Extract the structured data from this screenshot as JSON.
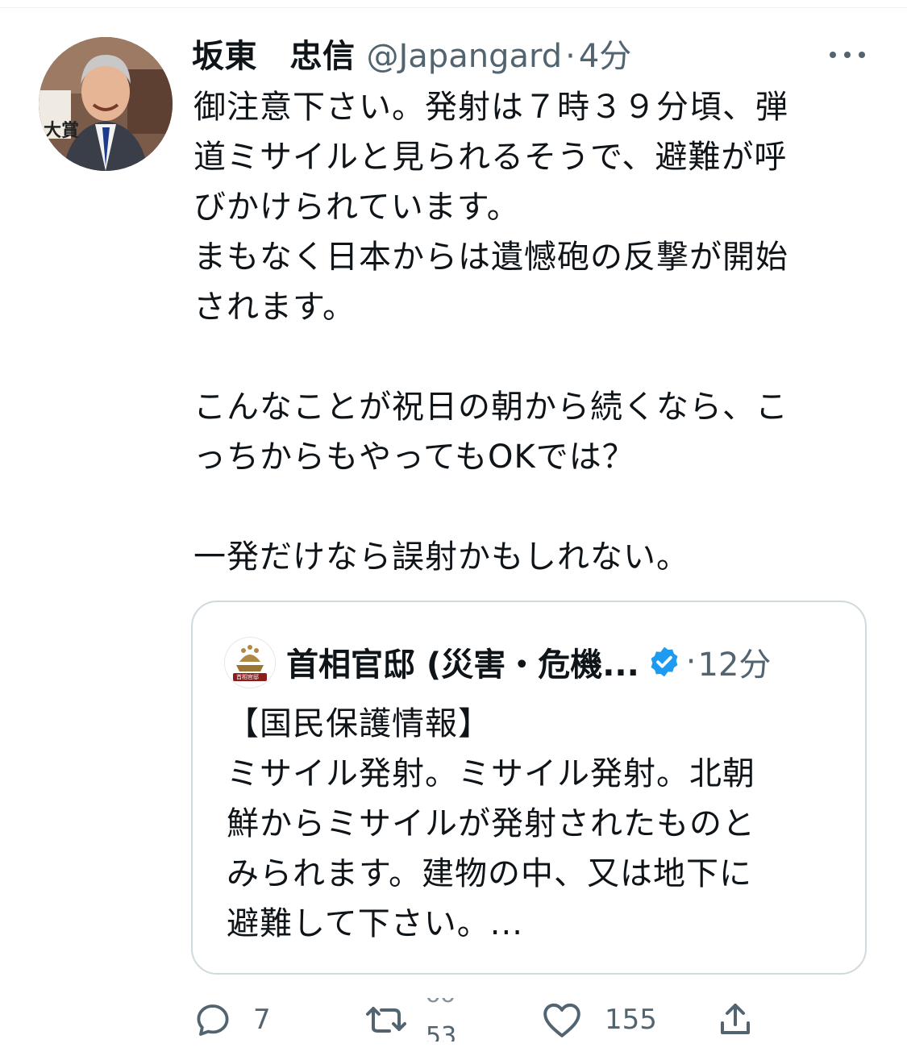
{
  "tweet": {
    "author_name": "坂東　忠信",
    "handle": "@Japangard",
    "separator": "·",
    "time": "4分",
    "avatar_badge": "大賞",
    "text_lines": [
      "御注意下さい。発射は７時３９分頃、弾",
      "道ミサイルと見られるそうで、避難が呼",
      "びかけられています。",
      "まもなく日本からは遺憾砲の反撃が開始",
      "されます。",
      "",
      "こんなことが祝日の朝から続くなら、こ",
      "っちからもやってもOKでは？",
      "",
      "一発だけなら誤射かもしれない。"
    ]
  },
  "quote": {
    "author_name": "首相官邸 (災害・危機...",
    "avatar_label": "首相官邸",
    "separator": "·",
    "time": "12分",
    "text_lines": [
      "【国民保護情報】",
      "ミサイル発射。ミサイル発射。北朝",
      "鮮からミサイルが発射されたものと",
      "みられます。建物の中、又は地下に",
      "避難して下さい。..."
    ]
  },
  "actions": {
    "reply_count": "7",
    "retweet_count_old": "ᴗᴗ",
    "retweet_count_new": "53",
    "like_count": "155"
  },
  "colors": {
    "text_primary": "#0f1419",
    "text_secondary": "#536471",
    "border": "#cfd9de",
    "verified_blue": "#1d9bf0"
  },
  "icons": [
    "more-icon",
    "verified-icon",
    "reply-icon",
    "retweet-icon",
    "like-icon",
    "share-icon"
  ]
}
